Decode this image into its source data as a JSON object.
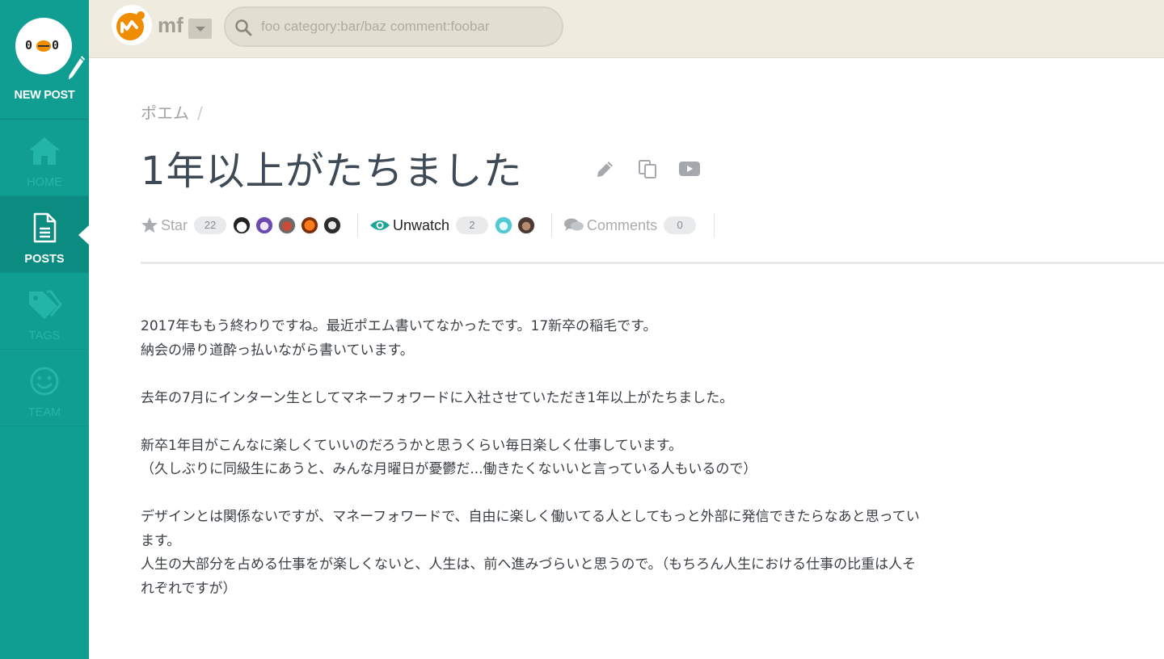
{
  "sidebar": {
    "new_post_label": "NEW POST",
    "avatar_face_left": "0",
    "avatar_face_right": "0",
    "items": [
      {
        "label": "HOME",
        "icon": "home-icon"
      },
      {
        "label": "POSTS",
        "icon": "document-icon",
        "active": true
      },
      {
        "label": "TAGS",
        "icon": "tags-icon"
      },
      {
        "label": "TEAM",
        "icon": "smile-icon"
      }
    ]
  },
  "topbar": {
    "team_name": "mf",
    "search_placeholder": "foo category:bar/baz comment:foobar"
  },
  "post": {
    "category": "ポエム",
    "breadcrumb_sep": "/",
    "title": "1年以上がたちました",
    "star_label": "Star",
    "star_count": "22",
    "watch_label": "Unwatch",
    "watch_count": "2",
    "comments_label": "Comments",
    "comments_count": "0",
    "paragraphs": [
      [
        "2017年ももう終わりですね。最近ポエム書いてなかったです。17新卒の稲毛です。",
        "納会の帰り道酔っ払いながら書いています。"
      ],
      [
        "去年の7月にインターン生としてマネーフォワードに入社させていただき1年以上がたちました。"
      ],
      [
        "新卒1年目がこんなに楽しくていいのだろうかと思うくらい毎日楽しく仕事しています。",
        "（久しぶりに同級生にあうと、みんな月曜日が憂鬱だ...働きたくないいと言っている人もいるので）"
      ],
      [
        "デザインとは関係ないですが、マネーフォワードで、自由に楽しく働いてる人としてもっと外部に発信できたらなあと思ってい",
        "ます。",
        "人生の大部分を占める仕事をが楽しくないと、人生は、前へ進みづらいと思うので。（もちろん人生における仕事の比重は人そ",
        "れぞれですが）"
      ]
    ]
  },
  "colors": {
    "sidebar": "#109e92",
    "topbar": "#efebde",
    "accent_orange": "#f08c00",
    "teal": "#1aa596"
  }
}
